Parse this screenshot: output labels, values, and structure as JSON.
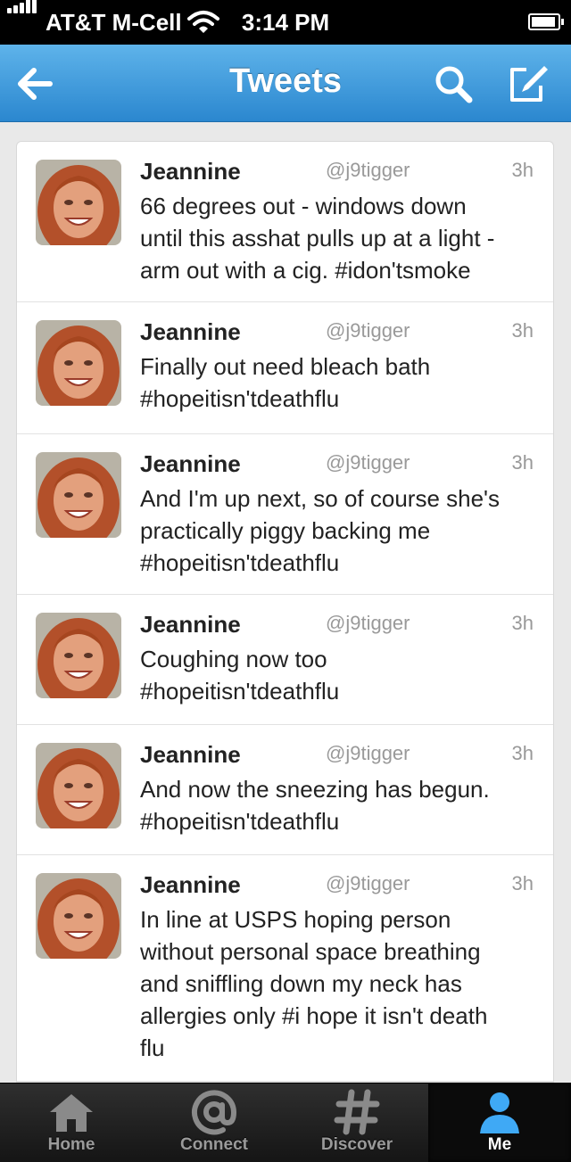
{
  "status_bar": {
    "carrier": "AT&T M-Cell",
    "time": "3:14 PM"
  },
  "nav": {
    "title": "Tweets",
    "back_icon": "back-arrow-icon",
    "search_icon": "search-icon",
    "compose_icon": "compose-icon"
  },
  "tweets": [
    {
      "name": "Jeannine",
      "handle": "@j9tigger",
      "time": "3h",
      "lines": [
        "66 degrees out - windows down",
        "until this asshat pulls up at a light -",
        "arm out with a cig. #idon'tsmoke"
      ]
    },
    {
      "name": "Jeannine",
      "handle": "@j9tigger",
      "time": "3h",
      "lines": [
        "Finally out need bleach bath",
        "#hopeitisn'tdeathflu"
      ]
    },
    {
      "name": "Jeannine",
      "handle": "@j9tigger",
      "time": "3h",
      "lines": [
        "And I'm up next, so of course she's",
        "practically piggy backing me",
        "#hopeitisn'tdeathflu"
      ]
    },
    {
      "name": "Jeannine",
      "handle": "@j9tigger",
      "time": "3h",
      "lines": [
        "Coughing now too",
        "#hopeitisn'tdeathflu"
      ]
    },
    {
      "name": "Jeannine",
      "handle": "@j9tigger",
      "time": "3h",
      "lines": [
        "And now the sneezing has begun.",
        "#hopeitisn'tdeathflu"
      ]
    },
    {
      "name": "Jeannine",
      "handle": "@j9tigger",
      "time": "3h",
      "lines": [
        "In line at USPS hoping person",
        "without personal space breathing",
        "and sniffling down my neck has",
        "allergies only #i hope it isn't death",
        "flu"
      ]
    }
  ],
  "tabs": [
    {
      "label": "Home",
      "icon": "home-icon",
      "active": false
    },
    {
      "label": "Connect",
      "icon": "at-sign-icon",
      "active": false
    },
    {
      "label": "Discover",
      "icon": "hashtag-icon",
      "active": false
    },
    {
      "label": "Me",
      "icon": "person-icon",
      "active": true
    }
  ],
  "colors": {
    "nav_blue": "#2b87cf",
    "active_tab_icon": "#3fa9f5",
    "tab_bar": "#1c1c1c"
  }
}
